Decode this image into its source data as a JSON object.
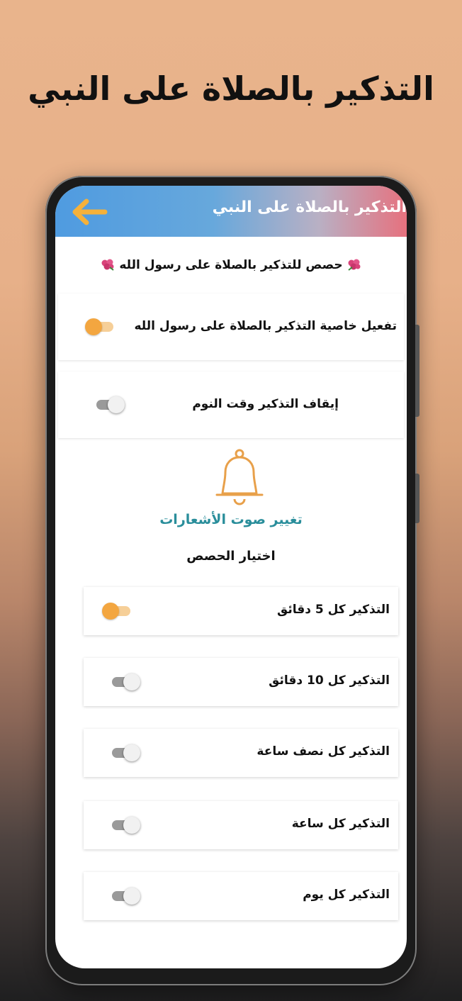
{
  "promo": {
    "title": "التذكير بالصلاة على النبي"
  },
  "appbar": {
    "title": "التذكير بالصلاة على النبي",
    "back_icon": "arrow-left-icon",
    "gradient": [
      "#4f9be0",
      "#e6717e"
    ]
  },
  "header": {
    "text": "حصص للتذكير بالصلاة على رسول الله",
    "icon": "flower-icon"
  },
  "settings": [
    {
      "label": "تفعيل خاصية التذكير بالصلاة على رسول الله",
      "enabled": true
    },
    {
      "label": "إيقاف التذكير وقت النوم",
      "enabled": false
    }
  ],
  "sound": {
    "icon": "bell-icon",
    "label": "تغيير صوت الأشعارات",
    "color": "#2a8e9b"
  },
  "intervals": {
    "title": "اختيار الحصص",
    "items": [
      {
        "label": "التذكير كل 5 دقائق",
        "enabled": true
      },
      {
        "label": "التذكير كل 10 دقائق",
        "enabled": false
      },
      {
        "label": "التذكير كل نصف ساعة",
        "enabled": false
      },
      {
        "label": "التذكير كل ساعة",
        "enabled": false
      },
      {
        "label": "التذكير كل يوم",
        "enabled": false
      }
    ]
  },
  "colors": {
    "toggle_on": "#f3a640",
    "toggle_off": "#9a9a9a",
    "accent": "#f5b13a"
  }
}
